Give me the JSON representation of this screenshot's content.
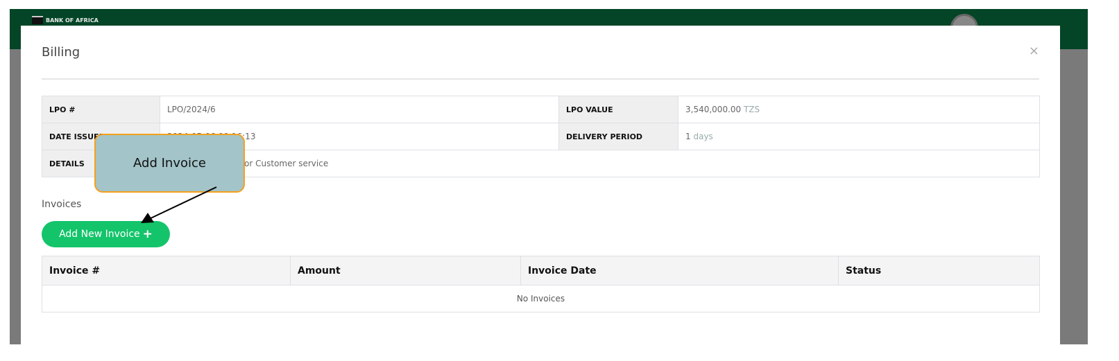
{
  "header": {
    "brand": "BANK OF AFRICA"
  },
  "modal": {
    "title": "Billing",
    "close_icon": "×",
    "lpo": {
      "lpo_number_label": "LPO #",
      "lpo_number": "LPO/2024/6",
      "lpo_value_label": "LPO VALUE",
      "lpo_value": "3,540,000.00",
      "currency": "TZS",
      "date_issued_label": "DATE ISSUED",
      "date_issued": "2024-05-06 09:16:13",
      "delivery_period_label": "DELIVERY PERIOD",
      "delivery_number": "1",
      "delivery_unit": "days",
      "details_label": "DETAILS",
      "details": "Laptop computer for Customer service"
    },
    "invoices_heading": "Invoices",
    "add_button": "Add New Invoice",
    "add_icon": "+",
    "table": {
      "columns": [
        "Invoice #",
        "Amount",
        "Invoice Date",
        "Status"
      ],
      "empty_text": "No Invoices"
    }
  },
  "annotation": {
    "callout": "Add Invoice",
    "colors": {
      "fill": "#a3c4c8",
      "border": "#f5a01a"
    }
  },
  "colors": {
    "header": "#034526",
    "button": "#14c46a"
  }
}
